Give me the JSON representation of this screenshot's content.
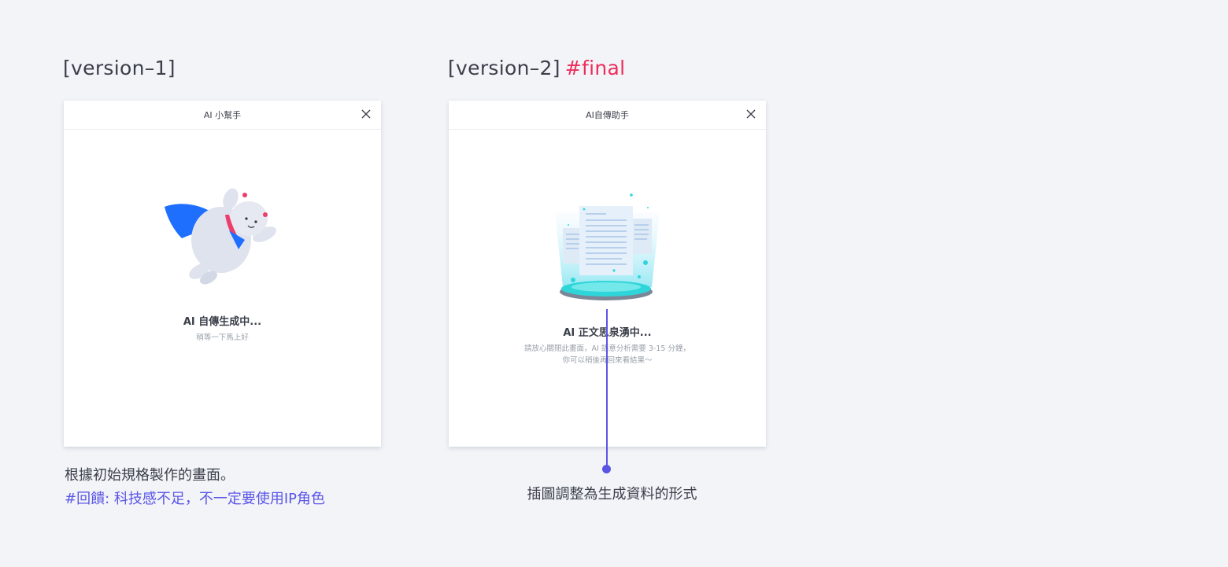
{
  "version1": {
    "heading": "[version–1]",
    "dialog_title": "AI 小幫手",
    "status_main": "AI 自傳生成中...",
    "status_sub": "稍等一下馬上好",
    "note_line1": "根據初始規格製作的畫面。",
    "note_line2": "#回饋: 科技感不足，不一定要使用IP角色"
  },
  "version2": {
    "heading": "[version–2]",
    "heading_tag": "#final",
    "dialog_title": "AI自傳助手",
    "status_main": "AI 正文思泉湧中...",
    "status_sub_line1": "請放心關閉此畫面，AI 語意分析需要 3-15 分鐘，",
    "status_sub_line2": "你可以稍後再回來看結果～",
    "callout": "插圖調整為生成資料的形式"
  },
  "icons": {
    "close": "close-icon",
    "mascot": "flying-bear-illustration",
    "documents": "document-generation-illustration"
  },
  "colors": {
    "accent_purple": "#5b55e6",
    "tag_pink": "#ee2d5b",
    "cape_blue": "#1f6fff",
    "scarf_pink": "#ee3d6b",
    "platform_teal": "#2fd6d9"
  }
}
